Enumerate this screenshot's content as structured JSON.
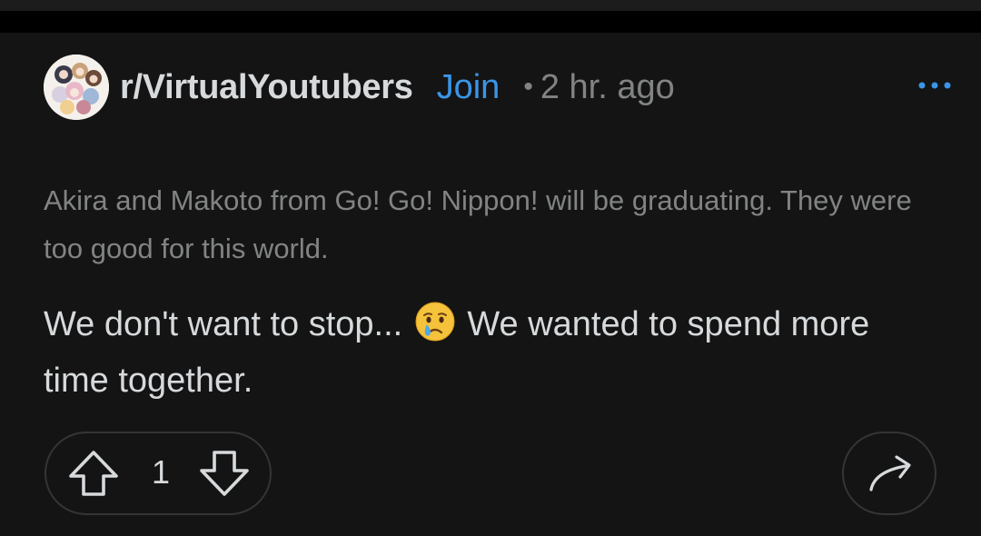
{
  "post": {
    "subreddit": "r/VirtualYoutubers",
    "join_label": "Join",
    "separator": "•",
    "time_ago": "2 hr. ago",
    "title": "Akira and Makoto from Go! Go! Nippon! will be graduating. They were too good for this world.",
    "body_part1": "We don't want to stop...",
    "body_part2": "We wanted to spend more time together.",
    "emoji": "crying-face-emoji"
  },
  "actions": {
    "vote_count": "1",
    "upvote_icon": "upvote-arrow-icon",
    "downvote_icon": "downvote-arrow-icon",
    "share_icon": "share-arrow-icon",
    "more_icon": "more-options-icon"
  },
  "colors": {
    "background": "#141414",
    "accent": "#3a95e8",
    "text_primary": "#d7dadc",
    "text_secondary": "#818384",
    "border": "#343536"
  }
}
